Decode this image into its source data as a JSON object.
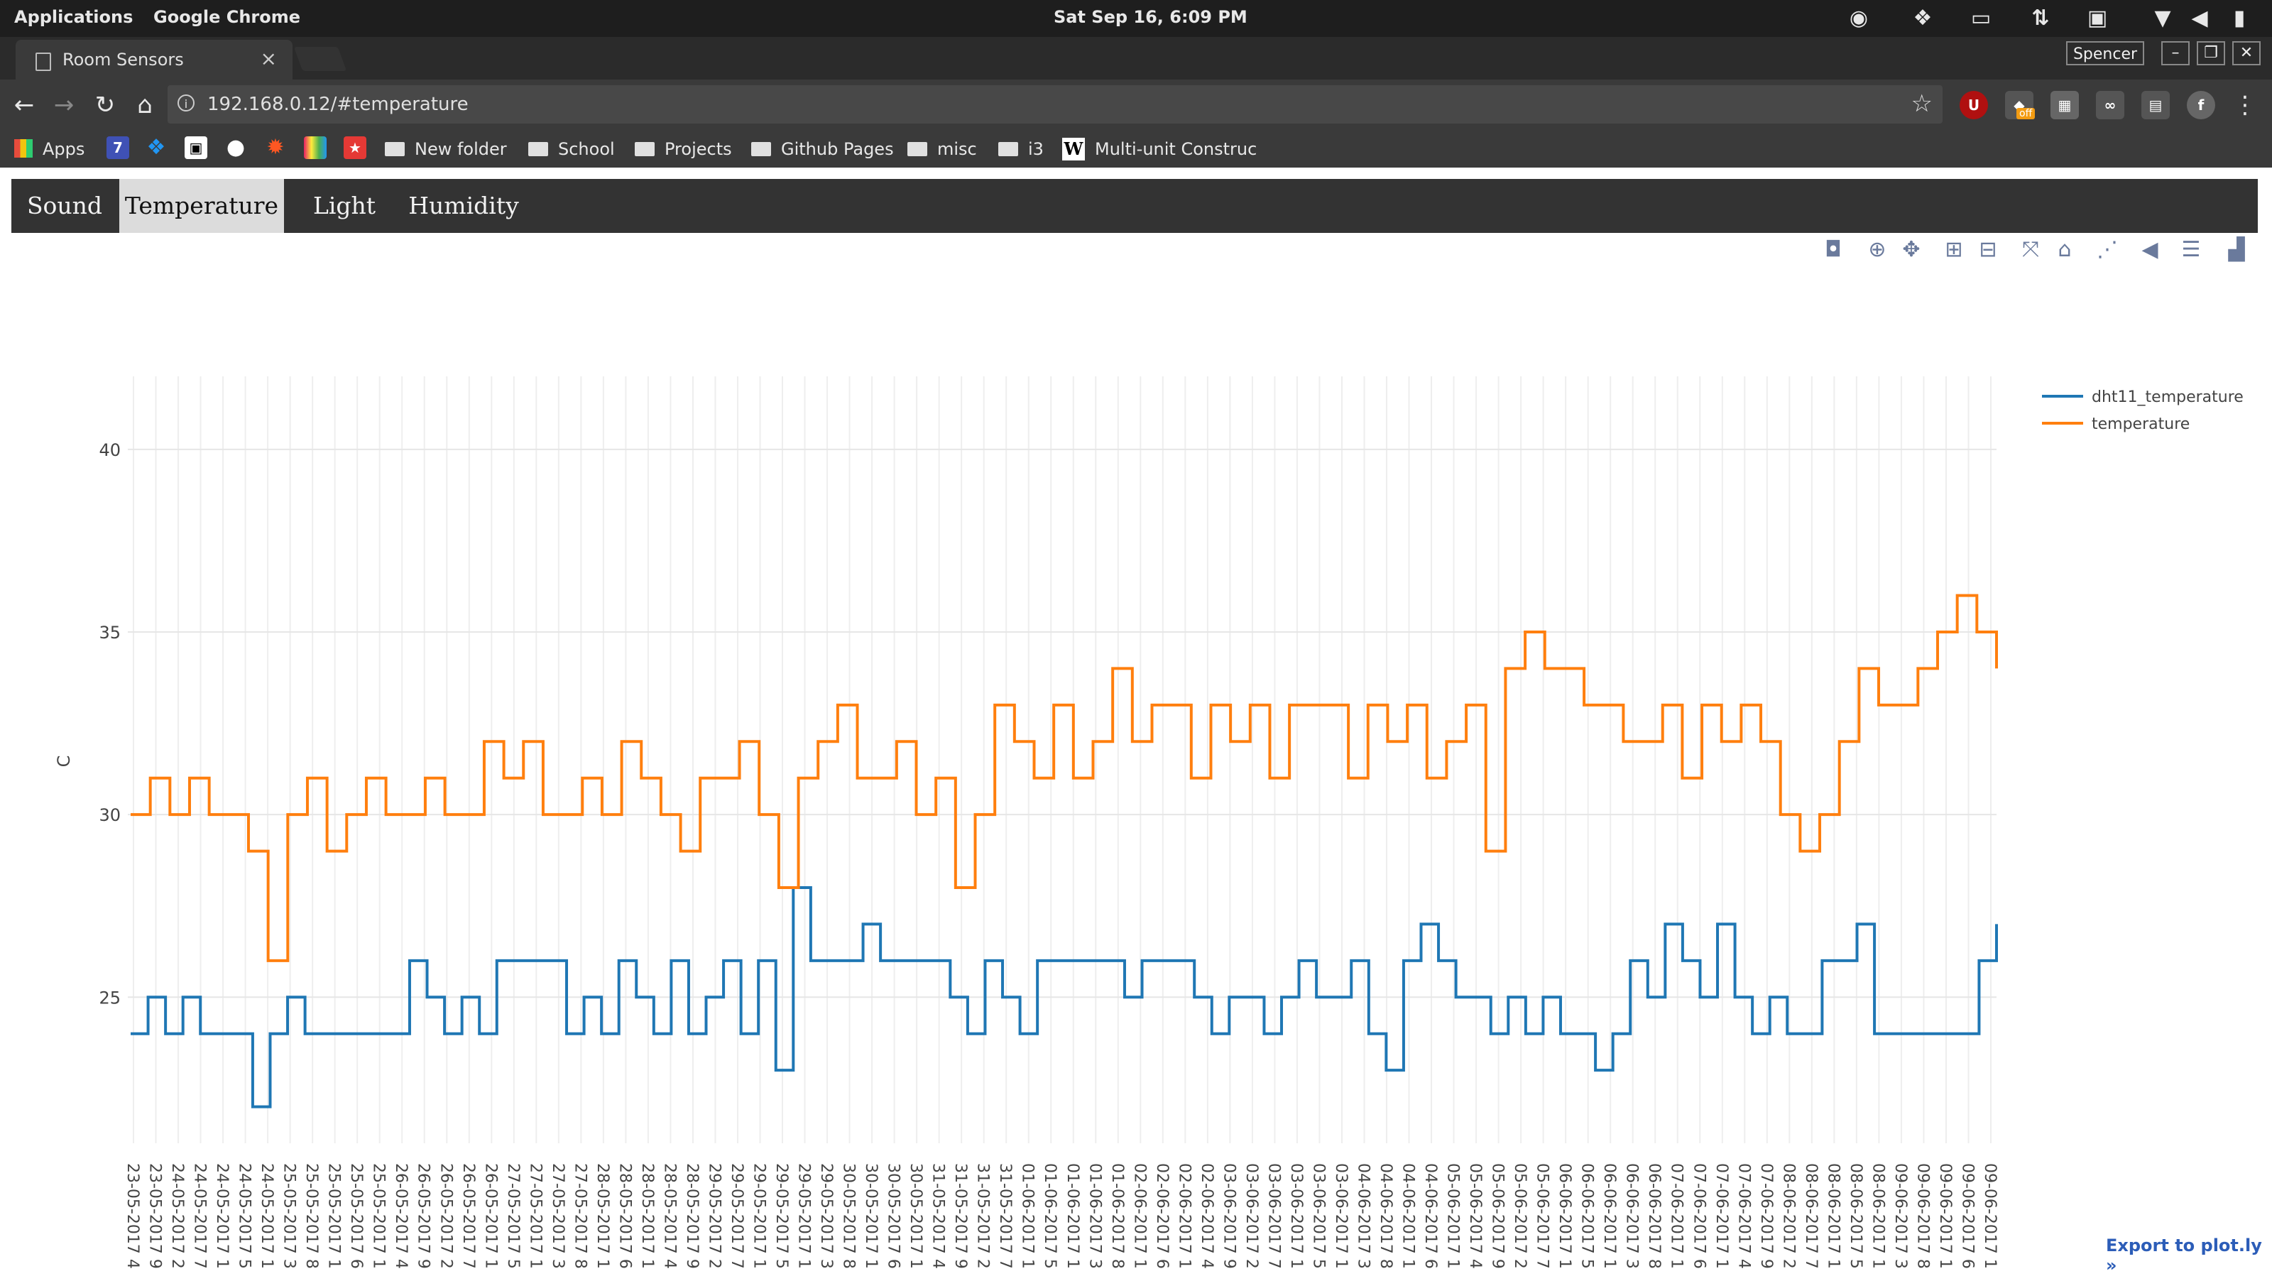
{
  "system_bar": {
    "applications": "Applications",
    "app_name": "Google Chrome",
    "clock": "Sat Sep 16,  6:09 PM"
  },
  "browser": {
    "tab_title": "Room Sensors",
    "tab_close": "×",
    "user": "Spencer",
    "url": "192.168.0.12/#temperature",
    "bookmarks": {
      "apps": "Apps",
      "folders": [
        "New folder",
        "School",
        "Projects",
        "Github Pages",
        "misc",
        "i3"
      ],
      "last": "Multi-unit Construc"
    },
    "extension_badge": "off"
  },
  "page": {
    "tabs": [
      "Sound",
      "Temperature",
      "Light",
      "Humidity"
    ],
    "active_tab": "Temperature",
    "export_link": "Export to plot.ly »"
  },
  "chart_data": {
    "type": "line",
    "ylabel": "C",
    "ylim": [
      21,
      42
    ],
    "yticks": [
      25,
      30,
      35,
      40
    ],
    "grid": true,
    "legend_placement": "top-right",
    "x": [
      "23-05-2017 4",
      "23-05-2017 9",
      "24-05-2017 2",
      "24-05-2017 7",
      "24-05-2017 1",
      "24-05-2017 5",
      "24-05-2017 1",
      "25-05-2017 3",
      "25-05-2017 8",
      "25-05-2017 1",
      "25-05-2017 6",
      "25-05-2017 1",
      "26-05-2017 4",
      "26-05-2017 9",
      "26-05-2017 2",
      "26-05-2017 7",
      "26-05-2017 1",
      "27-05-2017 5",
      "27-05-2017 1",
      "27-05-2017 3",
      "27-05-2017 8",
      "28-05-2017 1",
      "28-05-2017 6",
      "28-05-2017 1",
      "28-05-2017 4",
      "28-05-2017 9",
      "29-05-2017 2",
      "29-05-2017 7",
      "29-05-2017 1",
      "29-05-2017 5",
      "29-05-2017 1",
      "29-05-2017 3",
      "30-05-2017 8",
      "30-05-2017 1",
      "30-05-2017 6",
      "30-05-2017 1",
      "31-05-2017 4",
      "31-05-2017 9",
      "31-05-2017 2",
      "31-05-2017 7",
      "01-06-2017 1",
      "01-06-2017 5",
      "01-06-2017 1",
      "01-06-2017 3",
      "01-06-2017 8",
      "02-06-2017 1",
      "02-06-2017 6",
      "02-06-2017 1",
      "02-06-2017 4",
      "03-06-2017 9",
      "03-06-2017 2",
      "03-06-2017 7",
      "03-06-2017 1",
      "03-06-2017 5",
      "03-06-2017 1",
      "04-06-2017 3",
      "04-06-2017 8",
      "04-06-2017 1",
      "04-06-2017 6",
      "05-06-2017 1",
      "05-06-2017 4",
      "05-06-2017 9",
      "05-06-2017 2",
      "05-06-2017 7",
      "06-06-2017 1",
      "06-06-2017 5",
      "06-06-2017 1",
      "06-06-2017 3",
      "06-06-2017 8",
      "07-06-2017 1",
      "07-06-2017 6",
      "07-06-2017 1",
      "07-06-2017 4",
      "07-06-2017 9",
      "08-06-2017 2",
      "08-06-2017 7",
      "08-06-2017 1",
      "08-06-2017 5",
      "08-06-2017 1",
      "09-06-2017 3",
      "09-06-2017 8",
      "09-06-2017 1",
      "09-06-2017 6",
      "09-06-2017 1"
    ],
    "series": [
      {
        "name": "dht11_temperature",
        "color": "#1f77b4",
        "values": [
          24,
          25,
          24,
          25,
          24,
          24,
          24,
          22,
          24,
          25,
          24,
          24,
          24,
          24,
          24,
          24,
          26,
          25,
          24,
          25,
          24,
          26,
          26,
          26,
          26,
          24,
          25,
          24,
          26,
          25,
          24,
          26,
          24,
          25,
          26,
          24,
          26,
          23,
          28,
          26,
          26,
          26,
          27,
          26,
          26,
          26,
          26,
          25,
          24,
          26,
          25,
          24,
          26,
          26,
          26,
          26,
          26,
          25,
          26,
          26,
          26,
          25,
          24,
          25,
          25,
          24,
          25,
          26,
          25,
          25,
          26,
          24,
          23,
          26,
          27,
          26,
          25,
          25,
          24,
          25,
          24,
          25,
          24,
          24,
          23,
          24,
          26,
          25,
          27,
          26,
          25,
          27,
          25,
          24,
          25,
          24,
          24,
          26,
          26,
          27,
          24,
          24,
          24,
          24,
          24,
          24,
          26,
          27
        ]
      },
      {
        "name": "temperature",
        "color": "#ff7f0e",
        "values": [
          30,
          31,
          30,
          31,
          30,
          30,
          29,
          26,
          30,
          31,
          29,
          30,
          31,
          30,
          30,
          31,
          30,
          30,
          32,
          31,
          32,
          30,
          30,
          31,
          30,
          32,
          31,
          30,
          29,
          31,
          31,
          32,
          30,
          28,
          31,
          32,
          33,
          31,
          31,
          32,
          30,
          31,
          28,
          30,
          33,
          32,
          31,
          33,
          31,
          32,
          34,
          32,
          33,
          33,
          31,
          33,
          32,
          33,
          31,
          33,
          33,
          33,
          31,
          33,
          32,
          33,
          31,
          32,
          33,
          29,
          34,
          35,
          34,
          34,
          33,
          33,
          32,
          32,
          33,
          31,
          33,
          32,
          33,
          32,
          30,
          29,
          30,
          32,
          34,
          33,
          33,
          34,
          35,
          36,
          35,
          34
        ]
      }
    ]
  }
}
